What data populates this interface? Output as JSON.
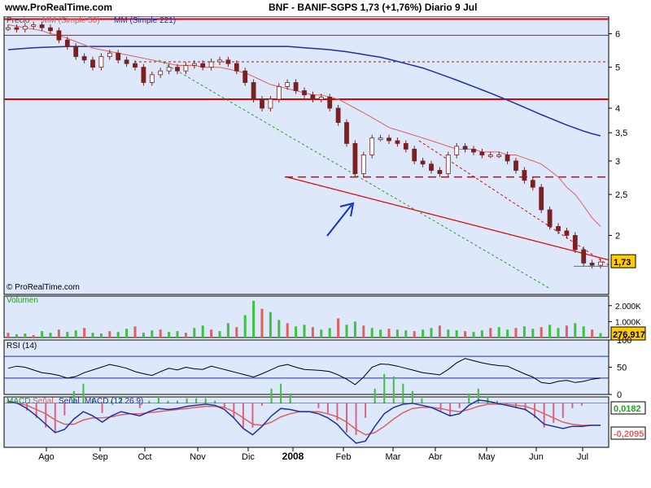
{
  "header": {
    "site": "www.ProRealTime.com",
    "title": "BNF - BANIF-SGPS      1,73 (+1,76%)   Diario  9 Jul"
  },
  "chart_data": [
    {
      "type": "line",
      "panel": "price",
      "scale": "log",
      "legend": [
        "Precio",
        "MM (Simple 50)",
        "MM (Simple 221)"
      ],
      "copyright": "© ProRealTime.com",
      "y_ticks": [
        "6",
        "5",
        "4",
        "3,5",
        "3",
        "2,5",
        "2"
      ],
      "ylim": [
        1.45,
        6.6
      ],
      "last_label": "1,73",
      "x_ticks": [
        "Ago",
        "Sep",
        "Oct",
        "Nov",
        "Dic",
        "2008",
        "Feb",
        "Mar",
        "Abr",
        "May",
        "Jun",
        "Jul"
      ],
      "price": [
        6.2,
        6.15,
        6.25,
        6.3,
        6.2,
        6.1,
        5.8,
        5.6,
        5.3,
        5.2,
        5.0,
        5.3,
        5.4,
        5.2,
        5.1,
        5.0,
        4.6,
        4.8,
        4.9,
        5.0,
        4.9,
        5.05,
        5.1,
        5.0,
        5.15,
        5.2,
        5.1,
        4.9,
        4.6,
        4.2,
        4.0,
        4.2,
        4.5,
        4.6,
        4.4,
        4.3,
        4.2,
        4.25,
        4.0,
        3.7,
        3.3,
        2.8,
        3.1,
        3.4,
        3.4,
        3.35,
        3.3,
        3.2,
        3.0,
        2.95,
        2.85,
        2.8,
        3.1,
        3.25,
        3.2,
        3.15,
        3.1,
        3.1,
        3.1,
        3.0,
        2.85,
        2.7,
        2.6,
        2.3,
        2.1,
        2.05,
        2.0,
        1.85,
        1.72,
        1.7,
        1.73
      ],
      "sma50": [
        6.3,
        6.25,
        6.2,
        6.15,
        6.1,
        6.0,
        5.95,
        5.85,
        5.75,
        5.65,
        5.55,
        5.5,
        5.45,
        5.4,
        5.35,
        5.3,
        5.25,
        5.2,
        5.15,
        5.1,
        5.05,
        5.05,
        5.05,
        5.0,
        5.0,
        5.0,
        4.95,
        4.9,
        4.85,
        4.75,
        4.65,
        4.55,
        4.5,
        4.45,
        4.4,
        4.35,
        4.3,
        4.3,
        4.25,
        4.2,
        4.1,
        4.0,
        3.9,
        3.8,
        3.7,
        3.6,
        3.55,
        3.5,
        3.45,
        3.4,
        3.35,
        3.3,
        3.25,
        3.2,
        3.2,
        3.2,
        3.15,
        3.15,
        3.15,
        3.1,
        3.1,
        3.05,
        3.0,
        2.95,
        2.85,
        2.75,
        2.6,
        2.5,
        2.35,
        2.2,
        2.1
      ],
      "sma221": [
        5.5,
        5.52,
        5.54,
        5.56,
        5.57,
        5.58,
        5.59,
        5.6,
        5.6,
        5.6,
        5.6,
        5.6,
        5.6,
        5.6,
        5.6,
        5.6,
        5.6,
        5.6,
        5.6,
        5.6,
        5.6,
        5.6,
        5.6,
        5.6,
        5.6,
        5.6,
        5.6,
        5.6,
        5.6,
        5.6,
        5.6,
        5.6,
        5.6,
        5.6,
        5.58,
        5.56,
        5.54,
        5.52,
        5.5,
        5.47,
        5.44,
        5.4,
        5.36,
        5.32,
        5.28,
        5.22,
        5.16,
        5.1,
        5.04,
        4.98,
        4.9,
        4.82,
        4.74,
        4.66,
        4.58,
        4.5,
        4.42,
        4.34,
        4.26,
        4.18,
        4.1,
        4.02,
        3.94,
        3.86,
        3.79,
        3.72,
        3.65,
        3.59,
        3.53,
        3.48,
        3.44
      ],
      "levels": [
        6.5,
        5.95,
        4.2
      ]
    },
    {
      "type": "bar",
      "panel": "volume",
      "legend": "Volumen",
      "y_ticks": [
        "2.000K",
        "1.000K"
      ],
      "last_label": "276.917",
      "values": [
        300,
        200,
        250,
        150,
        400,
        300,
        500,
        350,
        450,
        600,
        300,
        250,
        400,
        350,
        550,
        700,
        300,
        450,
        500,
        350,
        400,
        300,
        600,
        750,
        500,
        400,
        900,
        650,
        1400,
        2300,
        1800,
        1600,
        1100,
        900,
        700,
        800,
        650,
        500,
        600,
        1200,
        800,
        1000,
        750,
        600,
        500,
        550,
        500,
        450,
        400,
        500,
        600,
        750,
        500,
        450,
        400,
        350,
        450,
        600,
        650,
        500,
        600,
        700,
        550,
        650,
        800,
        600,
        750,
        900,
        700,
        500,
        277
      ]
    },
    {
      "type": "line",
      "panel": "rsi",
      "legend": "RSI (14)",
      "y_ticks": [
        "100",
        "50",
        "0"
      ],
      "ylim": [
        0,
        100
      ],
      "levels": [
        70,
        30
      ],
      "values": [
        48,
        52,
        50,
        45,
        40,
        38,
        35,
        30,
        33,
        40,
        45,
        50,
        55,
        52,
        48,
        42,
        38,
        35,
        42,
        48,
        45,
        50,
        47,
        46,
        52,
        48,
        44,
        40,
        36,
        32,
        38,
        45,
        52,
        55,
        50,
        46,
        45,
        44,
        42,
        36,
        28,
        18,
        32,
        50,
        56,
        55,
        52,
        48,
        44,
        40,
        38,
        36,
        46,
        58,
        66,
        62,
        58,
        55,
        53,
        52,
        45,
        38,
        32,
        22,
        20,
        24,
        26,
        22,
        24,
        28,
        30
      ]
    },
    {
      "type": "line",
      "panel": "macd",
      "legend": [
        "MACD",
        "Señal",
        "Señal",
        "MACD (12 26 9)"
      ],
      "values_label": [
        "0,0182",
        "-0,2095"
      ],
      "macd": [
        0.02,
        0.0,
        -0.05,
        -0.12,
        -0.2,
        -0.28,
        -0.25,
        -0.15,
        -0.08,
        -0.12,
        -0.18,
        -0.12,
        -0.08,
        -0.1,
        -0.12,
        -0.08,
        -0.05,
        -0.06,
        -0.05,
        -0.03,
        -0.02,
        -0.01,
        -0.02,
        -0.06,
        -0.14,
        -0.24,
        -0.3,
        -0.22,
        -0.12,
        -0.05,
        -0.06,
        -0.08,
        -0.08,
        -0.1,
        -0.14,
        -0.2,
        -0.3,
        -0.38,
        -0.36,
        -0.22,
        -0.1,
        -0.04,
        -0.01,
        0.0,
        -0.02,
        -0.04,
        -0.08,
        -0.12,
        -0.1,
        -0.02,
        0.03,
        0.02,
        0.0,
        -0.02,
        -0.04,
        -0.06,
        -0.12,
        -0.2,
        -0.22,
        -0.24,
        -0.22,
        -0.22,
        -0.21,
        -0.21
      ],
      "signal": [
        0.01,
        0.0,
        -0.02,
        -0.06,
        -0.1,
        -0.16,
        -0.2,
        -0.2,
        -0.16,
        -0.14,
        -0.14,
        -0.13,
        -0.11,
        -0.1,
        -0.1,
        -0.09,
        -0.08,
        -0.07,
        -0.06,
        -0.05,
        -0.04,
        -0.03,
        -0.03,
        -0.04,
        -0.08,
        -0.14,
        -0.2,
        -0.21,
        -0.18,
        -0.13,
        -0.1,
        -0.08,
        -0.08,
        -0.08,
        -0.1,
        -0.13,
        -0.18,
        -0.25,
        -0.3,
        -0.28,
        -0.22,
        -0.15,
        -0.09,
        -0.05,
        -0.04,
        -0.04,
        -0.05,
        -0.07,
        -0.08,
        -0.06,
        -0.03,
        -0.01,
        -0.01,
        -0.01,
        -0.02,
        -0.03,
        -0.06,
        -0.1,
        -0.14,
        -0.18,
        -0.2,
        -0.21,
        -0.21,
        -0.21
      ]
    }
  ],
  "colors": {
    "panel_bg": "#dde8fb",
    "price_candle": "#7a2020",
    "sma50": "#e06060",
    "sma221": "#2030a0",
    "level_line": "#e00000",
    "volume_up": "#40c040",
    "volume_down": "#e06060",
    "rsi_line": "#000000",
    "arrow": "#1030d0",
    "label_bg": "#ffcc00"
  }
}
